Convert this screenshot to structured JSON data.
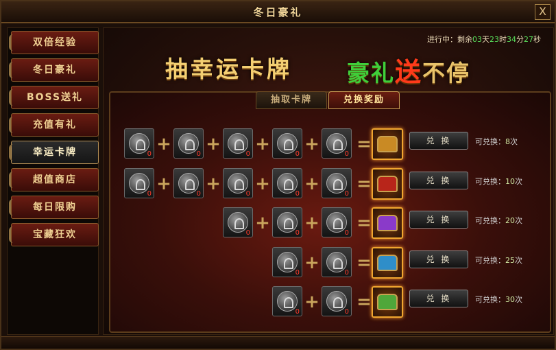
{
  "window": {
    "title": "冬日豪礼",
    "close_label": "X"
  },
  "sidebar": {
    "items": [
      {
        "label": "双倍经验",
        "active": false
      },
      {
        "label": "冬日豪礼",
        "active": false
      },
      {
        "label": "BOSS送礼",
        "active": false
      },
      {
        "label": "充值有礼",
        "active": false
      },
      {
        "label": "幸运卡牌",
        "active": true
      },
      {
        "label": "超值商店",
        "active": false
      },
      {
        "label": "每日限购",
        "active": false
      },
      {
        "label": "宝藏狂欢",
        "active": false
      }
    ]
  },
  "status": {
    "prefix": "进行中：剩余",
    "days": "03",
    "days_unit": "天",
    "hours": "23",
    "hours_unit": "时",
    "minutes": "34",
    "minutes_unit": "分",
    "seconds": "27",
    "seconds_unit": "秒"
  },
  "banner": {
    "left": "抽幸运卡牌",
    "right_a": "豪礼",
    "right_b": "送",
    "right_c": "不停"
  },
  "tabs": {
    "draw": "抽取卡牌",
    "exchange": "兑换奖励",
    "active": "exchange"
  },
  "exchange": {
    "button_label": "兑 换",
    "avail_prefix": "可兑换：",
    "avail_suffix": "次",
    "rows": [
      {
        "inputs": [
          "0",
          "0",
          "0",
          "0",
          "0"
        ],
        "reward": "gold-armor-icon",
        "times": "8"
      },
      {
        "inputs": [
          "0",
          "0",
          "0",
          "0",
          "0"
        ],
        "reward": "red-chest-icon",
        "times": "10"
      },
      {
        "inputs": [
          "0",
          "0",
          "0"
        ],
        "reward": "purple-chest-icon",
        "times": "20"
      },
      {
        "inputs": [
          "0",
          "0"
        ],
        "reward": "blue-chest-icon",
        "times": "25"
      },
      {
        "inputs": [
          "0",
          "0"
        ],
        "reward": "green-chest-icon",
        "times": "30"
      }
    ]
  },
  "colors": {
    "accent_gold": "#f4cf72",
    "count_red": "#ff3a2a",
    "timer_green": "#59e05b",
    "reward_glow": "#ff9c2a",
    "chest_colors": {
      "gold-armor-icon": "#c98a24",
      "red-chest-icon": "#b8251a",
      "purple-chest-icon": "#8a3ac9",
      "blue-chest-icon": "#2f8ec9",
      "green-chest-icon": "#4fa73a"
    }
  }
}
